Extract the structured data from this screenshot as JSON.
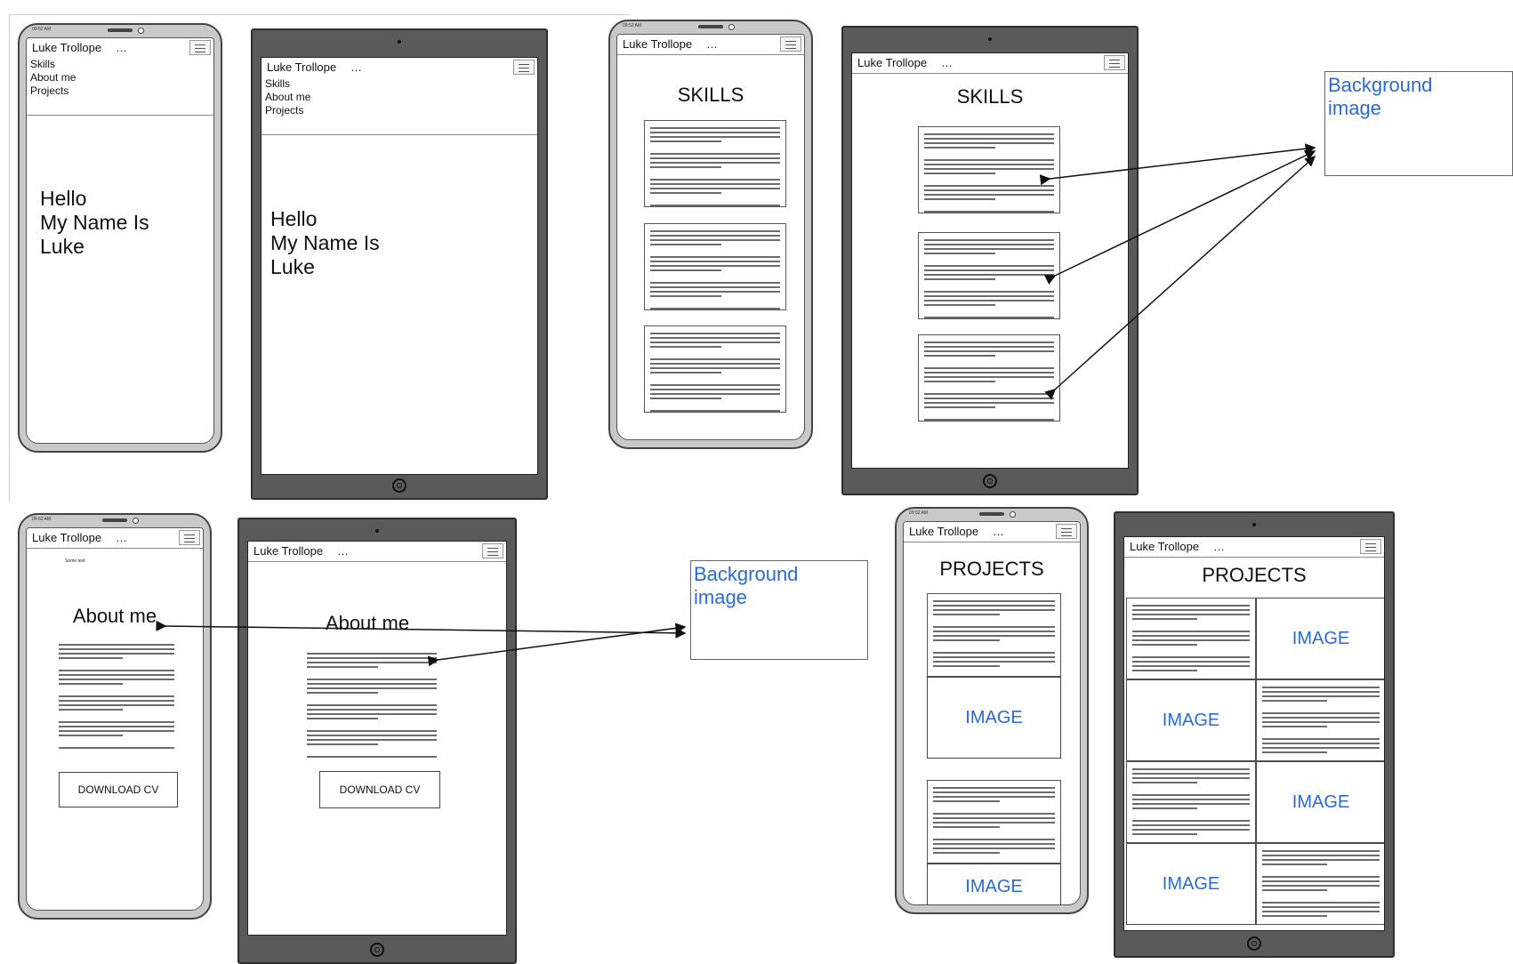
{
  "brand": "Luke Trollope",
  "menu_items": [
    "Skills",
    "About me",
    "Projects"
  ],
  "hero": {
    "line1": "Hello",
    "line2": "My Name Is",
    "line3": "Luke"
  },
  "skills_heading": "SKILLS",
  "about_heading": "About me",
  "about_small_text": "Some text",
  "download_button": "DOWNLOAD CV",
  "projects_heading": "PROJECTS",
  "image_label": "IMAGE",
  "note": {
    "line1": "Background",
    "line2": "image"
  },
  "status_time": "09:52 AM",
  "colors": {
    "annotation": "#2a6ad4",
    "frame_phone": "#c9c9c9",
    "frame_tablet": "#5a5a5a"
  }
}
